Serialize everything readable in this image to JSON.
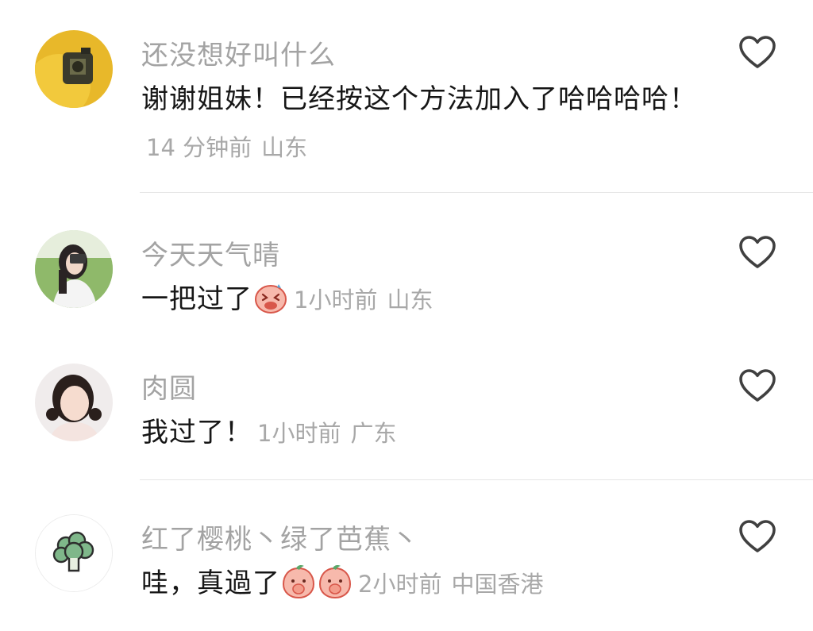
{
  "comments": [
    {
      "username": "还没想好叫什么",
      "text": "谢谢姐妹！已经按这个方法加入了哈哈哈哈！",
      "time": "14 分钟前",
      "location": "山东",
      "avatar": "avatar-yellow-camera-icon"
    },
    {
      "username": "今天天气晴",
      "text": "一把过了",
      "emojis": [
        "laughing-pig-emoji"
      ],
      "time": "1小时前",
      "location": "山东",
      "avatar": "avatar-girl-photographing"
    },
    {
      "username": "肉圆",
      "text": "我过了！",
      "time": "1小时前",
      "location": "广东",
      "avatar": "avatar-girl-portrait"
    },
    {
      "username": "红了樱桃丶绿了芭蕉丶",
      "text": "哇，真過了",
      "emojis": [
        "covering-mouth-peach-emoji",
        "covering-mouth-peach-emoji"
      ],
      "time": "2小时前",
      "location": "中国香港",
      "avatar": "avatar-broccoli-icon"
    }
  ],
  "colors": {
    "username": "#a3a3a3",
    "text": "#161616",
    "meta": "#a8a8a8",
    "divider": "#e6e6e6",
    "like_icon": "#404040"
  }
}
